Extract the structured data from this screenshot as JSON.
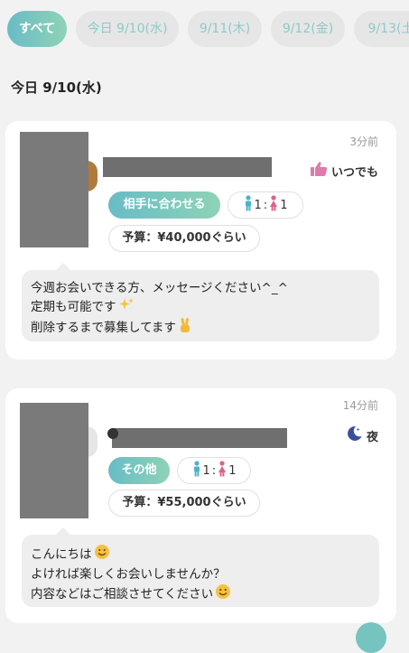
{
  "tabs": [
    {
      "label": "すべて",
      "active": true
    },
    {
      "label": "今日 9/10(水)",
      "active": false
    },
    {
      "label": "9/11(木)",
      "active": false
    },
    {
      "label": "9/12(金)",
      "active": false
    },
    {
      "label": "9/13(土",
      "active": false
    }
  ],
  "date_heading": "今日 9/10(水)",
  "posts": [
    {
      "time": "3分前",
      "availability": {
        "icon": "thumbs-up-icon",
        "label": "いつでも"
      },
      "type_label": "相手に合わせる",
      "ratio": {
        "male": "1",
        "female": "1",
        "separator": ":"
      },
      "budget": "予算：¥40,000ぐらい",
      "message_lines": [
        "今週お会いできる方、メッセージください^_^",
        "定期も可能です",
        "削除するまで募集してます"
      ]
    },
    {
      "time": "14分前",
      "availability": {
        "icon": "moon-icon",
        "label": "夜"
      },
      "type_label": "その他",
      "ratio": {
        "male": "1",
        "female": "1",
        "separator": ":"
      },
      "budget": "予算：¥55,000ぐらい",
      "message_lines": [
        "こんにちは",
        "よければ楽しくお会いしませんか？",
        "内容などはご相談させてください"
      ]
    }
  ],
  "colors": {
    "accent_start": "#69bcc6",
    "accent_end": "#8ed3b7",
    "male_icon": "#4ab3c8",
    "female_icon": "#e0608a",
    "like_icon": "#e07aa8",
    "moon_icon": "#3a4f9a"
  }
}
